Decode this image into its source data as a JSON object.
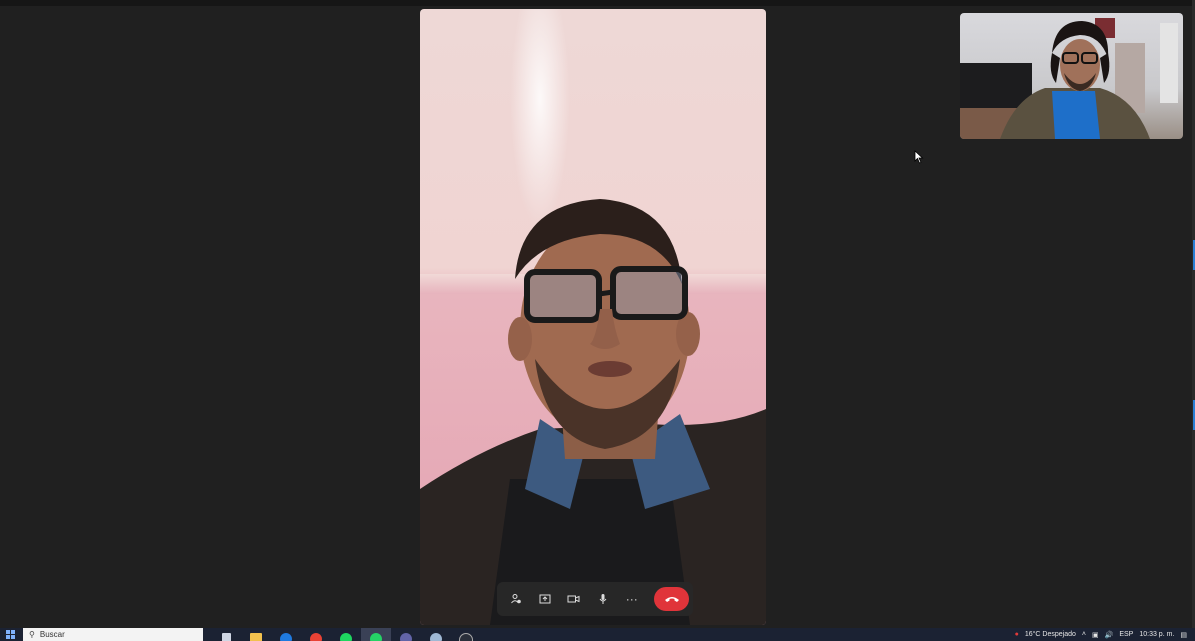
{
  "call": {
    "controls": {
      "participants_icon": "people-icon",
      "share_icon": "share-screen-icon",
      "camera_icon": "video-camera-icon",
      "mic_icon": "microphone-icon",
      "more_label": "···",
      "end_icon": "phone-hangup-icon"
    },
    "colors": {
      "end_call": "#e0343a",
      "background": "#202020"
    }
  },
  "taskbar": {
    "search_placeholder": "Buscar",
    "apps": [
      "task-view",
      "file-explorer",
      "mail",
      "chrome",
      "spotify",
      "whatsapp",
      "teams",
      "photos",
      "steam"
    ],
    "weather": "16°C  Despejado",
    "language": "ESP",
    "time": "10:33 p. m."
  }
}
